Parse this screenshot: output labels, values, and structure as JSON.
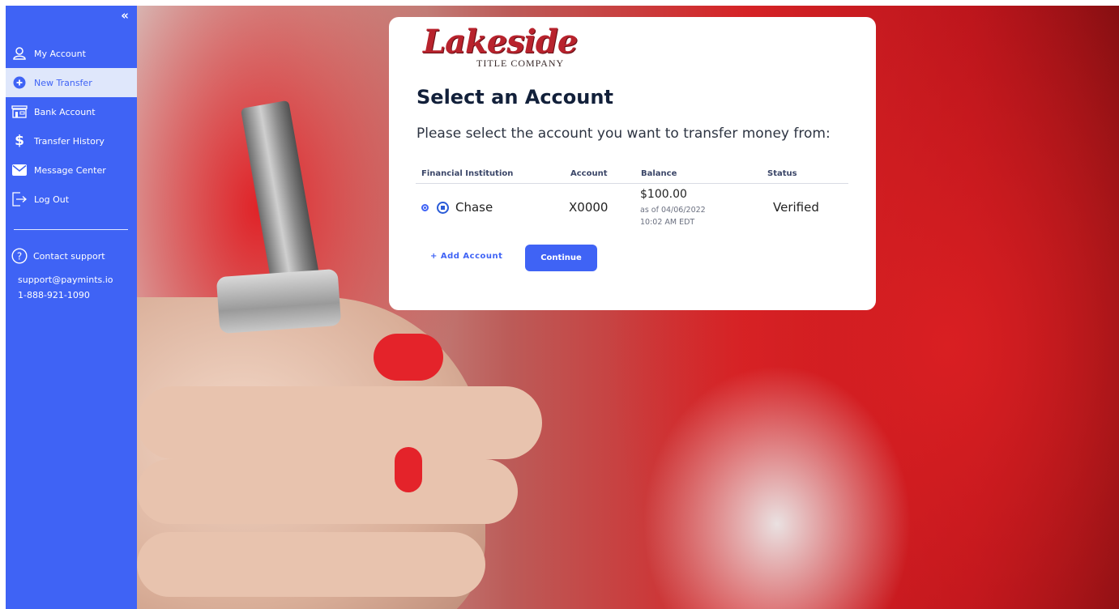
{
  "sidebar": {
    "collapse_label": "«",
    "items": [
      {
        "label": "My Account",
        "icon": "user-icon"
      },
      {
        "label": "New Transfer",
        "icon": "plus-circle-icon",
        "active": true
      },
      {
        "label": "Bank Account",
        "icon": "bank-building-icon"
      },
      {
        "label": "Transfer History",
        "icon": "dollar-icon"
      },
      {
        "label": "Message Center",
        "icon": "envelope-icon"
      },
      {
        "label": "Log Out",
        "icon": "logout-icon"
      }
    ],
    "support": {
      "label": "Contact support",
      "icon": "question-circle-icon",
      "email": "support@paymints.io",
      "phone": "1-888-921-1090"
    }
  },
  "logo": {
    "word": "Lakeside",
    "subtitle": "TITLE COMPANY"
  },
  "card": {
    "title": "Select an Account",
    "subtitle": "Please select the account you want to transfer money from:",
    "columns": [
      "Financial Institution",
      "Account",
      "Balance",
      "Status"
    ],
    "rows": [
      {
        "institution": "Chase",
        "account": "X0000",
        "balance": "$100.00",
        "as_of": "as of 04/06/2022",
        "time": "10:02 AM EDT",
        "status": "Verified",
        "selected": true
      }
    ],
    "add_account_label": "+ Add Account",
    "continue_label": "Continue"
  },
  "colors": {
    "sidebar": "#3f63f5",
    "active_item_bg": "#dfe7fb",
    "primary_button": "#3f63f5",
    "logo_red": "#b8232d"
  }
}
